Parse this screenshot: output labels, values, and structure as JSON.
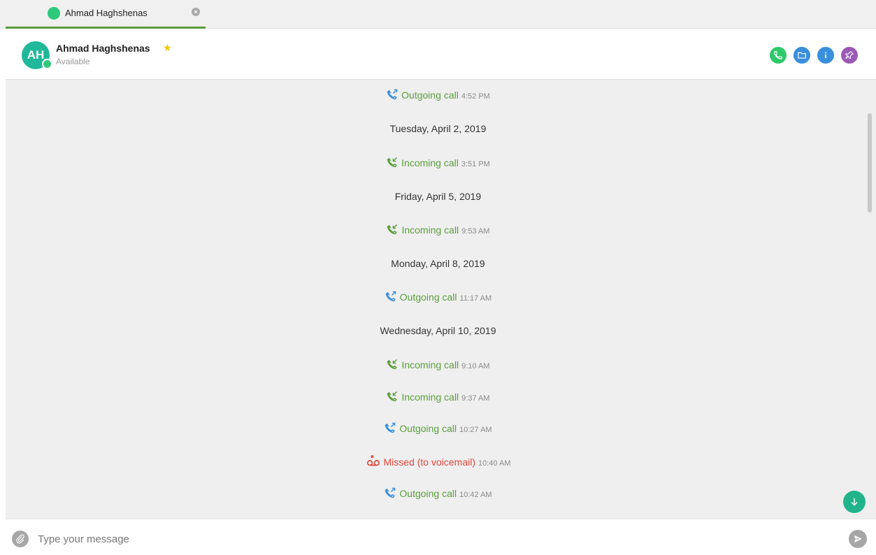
{
  "tab": {
    "title": "Ahmad Haghshenas",
    "status_color": "#2ec97a",
    "close_icon": "close-icon"
  },
  "contact": {
    "initials": "AH",
    "name": "Ahmad Haghshenas",
    "status": "Available",
    "favorite_icon": "star-icon",
    "avatar_color": "#1fb99a"
  },
  "header_actions": [
    {
      "name": "call-button",
      "icon": "phone-icon",
      "color": "#2ec96a"
    },
    {
      "name": "files-button",
      "icon": "folder-icon",
      "color": "#3a8fdc"
    },
    {
      "name": "info-button",
      "icon": "info-icon",
      "color": "#3a8fdc"
    },
    {
      "name": "pin-button",
      "icon": "pin-icon",
      "color": "#9b59b6"
    }
  ],
  "history": [
    {
      "kind": "call",
      "type": "out",
      "label": "Outgoing call",
      "time": "4:52 PM"
    },
    {
      "kind": "date",
      "text": "Tuesday, April 2, 2019"
    },
    {
      "kind": "call",
      "type": "in",
      "label": "Incoming call",
      "time": "3:51 PM"
    },
    {
      "kind": "date",
      "text": "Friday, April 5, 2019"
    },
    {
      "kind": "call",
      "type": "in",
      "label": "Incoming call",
      "time": "9:53 AM"
    },
    {
      "kind": "date",
      "text": "Monday, April 8, 2019"
    },
    {
      "kind": "call",
      "type": "out",
      "label": "Outgoing call",
      "time": "11:17 AM"
    },
    {
      "kind": "date",
      "text": "Wednesday, April 10, 2019"
    },
    {
      "kind": "call",
      "type": "in",
      "label": "Incoming call",
      "time": "9:10 AM"
    },
    {
      "kind": "call",
      "type": "in",
      "label": "Incoming call",
      "time": "9:37 AM"
    },
    {
      "kind": "call",
      "type": "out",
      "label": "Outgoing call",
      "time": "10:27 AM"
    },
    {
      "kind": "call",
      "type": "missed",
      "label": "Missed (to voicemail)",
      "time": "10:40 AM"
    },
    {
      "kind": "call",
      "type": "out",
      "label": "Outgoing call",
      "time": "10:42 AM"
    }
  ],
  "composer": {
    "placeholder": "Type your message",
    "attach_icon": "paperclip-icon",
    "send_icon": "send-icon"
  },
  "colors": {
    "incoming": "#5a9e3c",
    "outgoing_icon": "#3a8fdc",
    "missed": "#e0463c",
    "accent": "#21b38a"
  }
}
